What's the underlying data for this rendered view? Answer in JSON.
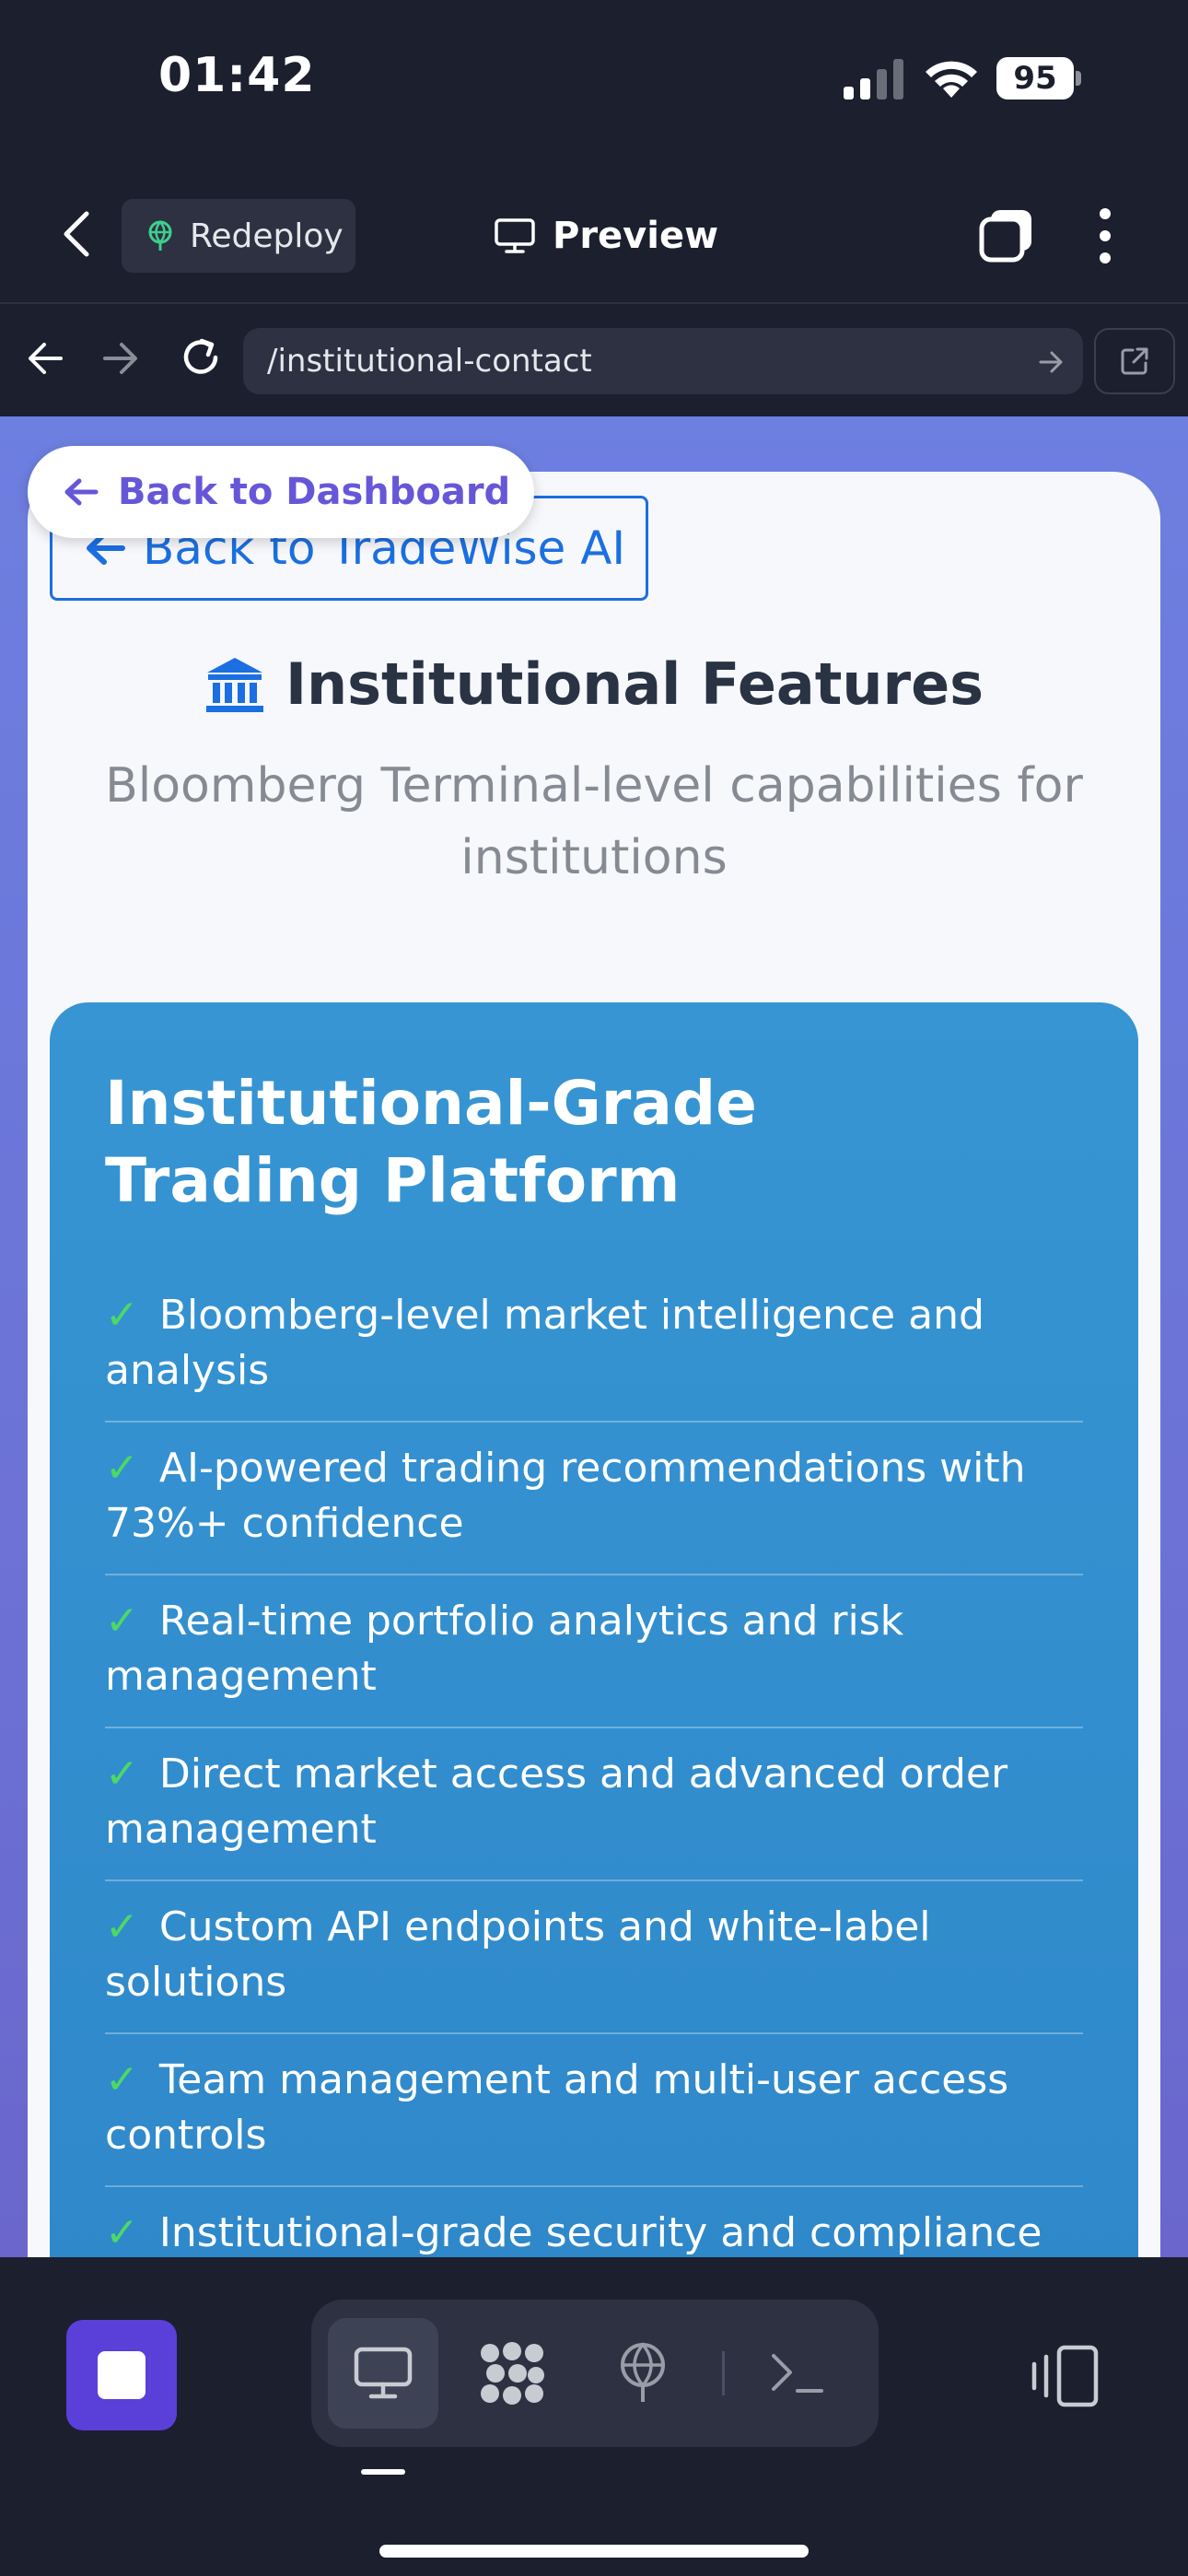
{
  "status_bar": {
    "time": "01:42",
    "battery_level": "95",
    "icons": [
      "cellular-signal-icon",
      "wifi-icon",
      "battery-icon"
    ]
  },
  "app_header": {
    "redeploy_label": "Redeploy",
    "preview_label": "Preview",
    "icons": [
      "chevron-left-icon",
      "globe-deploy-icon",
      "monitor-icon",
      "tabs-icon",
      "more-vertical-icon"
    ]
  },
  "browser": {
    "url": "/institutional-contact",
    "icons": [
      "arrow-left-icon",
      "arrow-right-icon",
      "reload-icon",
      "arrow-go-icon",
      "open-external-icon"
    ]
  },
  "page": {
    "back_dashboard_label": "Back to Dashboard",
    "back_tradewise_label": "Back to TradeWise AI",
    "heading_icon": "🏛",
    "heading": "Institutional Features",
    "subheading": "Bloomberg Terminal-level capabilities for institutions",
    "panel_title": "Institutional-Grade Trading Platform",
    "check_mark": "✓",
    "features": [
      "Bloomberg-level market intelligence and analysis",
      "AI-powered trading recommendations with 73%+ confidence",
      "Real-time portfolio analytics and risk management",
      "Direct market access and advanced order management",
      "Custom API endpoints and white-label solutions",
      "Team management and multi-user access controls",
      "Institutional-grade security and compliance"
    ]
  },
  "bottom_toolbar": {
    "icons": [
      "stop-icon",
      "desktop-icon",
      "apps-icon",
      "deploy-icon",
      "terminal-icon",
      "devices-icon"
    ],
    "accent_color": "#5b3fd9"
  },
  "colors": {
    "app_background": "#1c1f2e",
    "panel_gradient_top": "#3795d3",
    "link_blue": "#1b6fe0",
    "dashboard_purple": "#6657d8",
    "check_green": "#4cd964"
  }
}
